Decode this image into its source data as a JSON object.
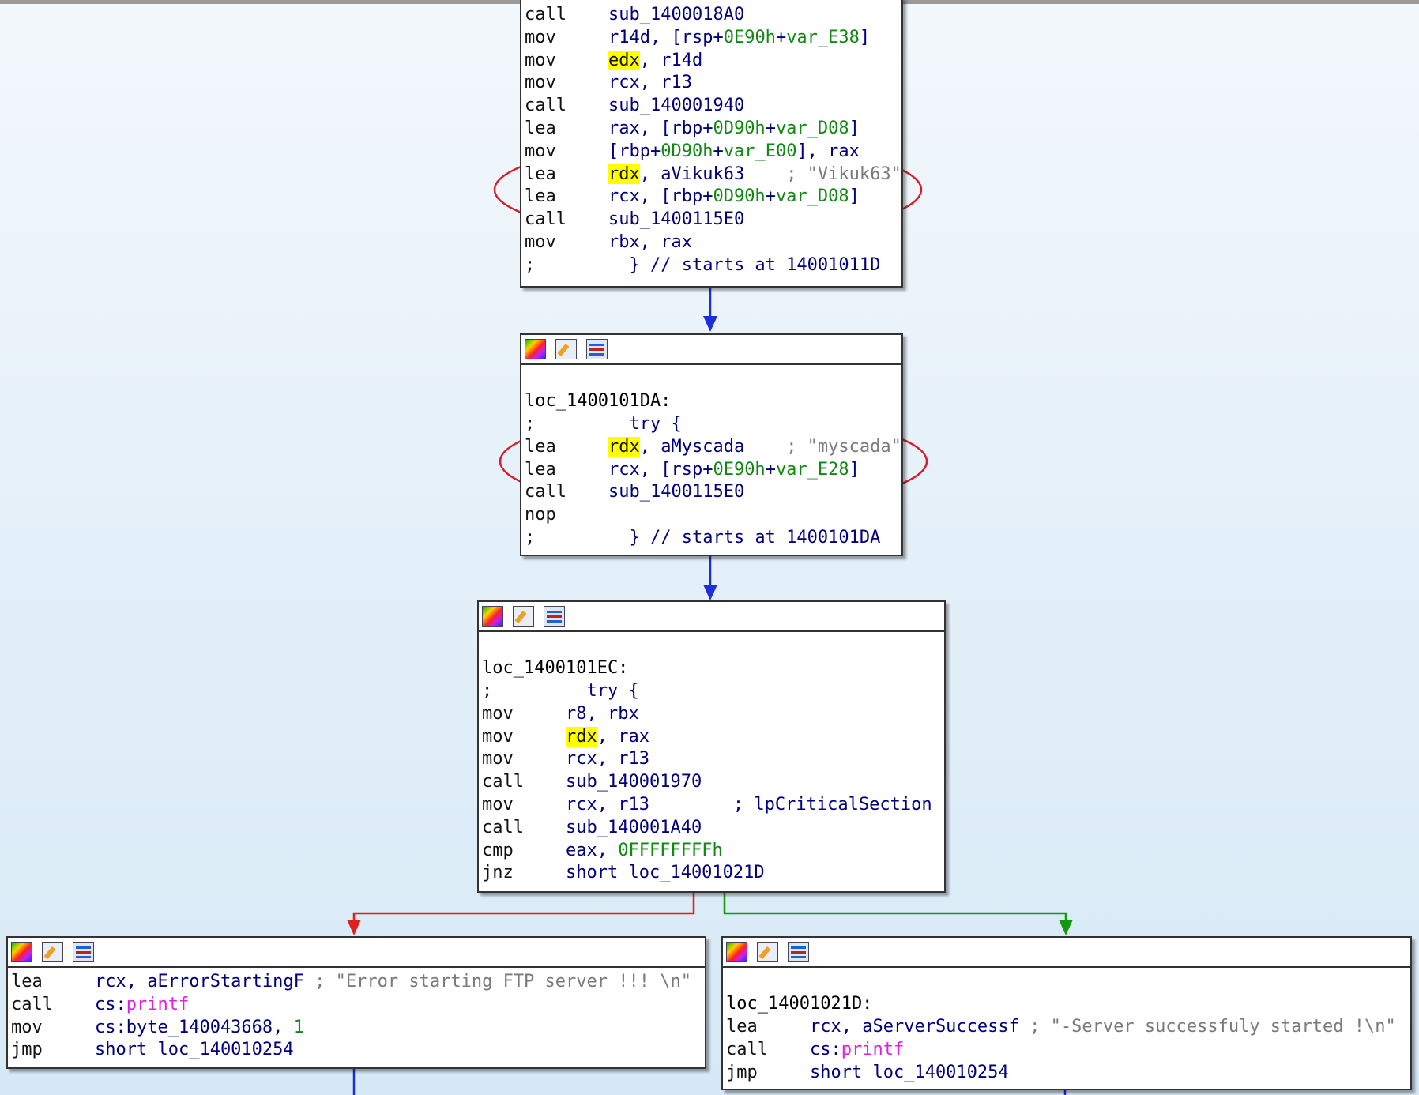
{
  "block_top": {
    "lines": [
      {
        "mn": "call",
        "ops": [
          {
            "t": "sub_1400018A0",
            "c": "ops-blue"
          }
        ]
      },
      {
        "mn": "mov",
        "ops": [
          {
            "t": "r14d, [rsp+",
            "c": "ops-blue"
          },
          {
            "t": "0E90h",
            "c": "num"
          },
          {
            "t": "+",
            "c": "ops-blue"
          },
          {
            "t": "var_E38",
            "c": "num"
          },
          {
            "t": "]",
            "c": "ops-blue"
          }
        ]
      },
      {
        "mn": "mov",
        "ops": [
          {
            "t": "edx",
            "c": "hl"
          },
          {
            "t": ", r14d",
            "c": "ops-blue"
          }
        ]
      },
      {
        "mn": "mov",
        "ops": [
          {
            "t": "rcx, r13",
            "c": "ops-blue"
          }
        ]
      },
      {
        "mn": "call",
        "ops": [
          {
            "t": "sub_140001940",
            "c": "ops-blue"
          }
        ]
      },
      {
        "mn": "lea",
        "ops": [
          {
            "t": "rax, [rbp+",
            "c": "ops-blue"
          },
          {
            "t": "0D90h",
            "c": "num"
          },
          {
            "t": "+",
            "c": "ops-blue"
          },
          {
            "t": "var_D08",
            "c": "num"
          },
          {
            "t": "]",
            "c": "ops-blue"
          }
        ]
      },
      {
        "mn": "mov",
        "ops": [
          {
            "t": "[rbp+",
            "c": "ops-blue"
          },
          {
            "t": "0D90h",
            "c": "num"
          },
          {
            "t": "+",
            "c": "ops-blue"
          },
          {
            "t": "var_E00",
            "c": "num"
          },
          {
            "t": "], rax",
            "c": "ops-blue"
          }
        ]
      },
      {
        "mn": "lea",
        "ops": [
          {
            "t": "rdx",
            "c": "hl"
          },
          {
            "t": ", aVikuk63    ",
            "c": "ops-blue"
          },
          {
            "t": "; \"Vikuk63\"",
            "c": "cmt"
          }
        ]
      },
      {
        "mn": "lea",
        "ops": [
          {
            "t": "rcx, [rbp+",
            "c": "ops-blue"
          },
          {
            "t": "0D90h",
            "c": "num"
          },
          {
            "t": "+",
            "c": "ops-blue"
          },
          {
            "t": "var_D08",
            "c": "num"
          },
          {
            "t": "]",
            "c": "ops-blue"
          }
        ]
      },
      {
        "mn": "call",
        "ops": [
          {
            "t": "sub_1400115E0",
            "c": "ops-blue"
          }
        ]
      },
      {
        "mn": "mov",
        "ops": [
          {
            "t": "rbx, rax",
            "c": "ops-blue"
          }
        ]
      },
      {
        "mn": ";",
        "ops": [
          {
            "t": "  } // starts at 14001011D",
            "c": "ops-blue"
          }
        ]
      }
    ]
  },
  "block_try1": {
    "label": "loc_1400101DA:",
    "lines": [
      {
        "mn": ";",
        "ops": [
          {
            "t": "  try {",
            "c": "ops-blue"
          }
        ]
      },
      {
        "mn": "lea",
        "ops": [
          {
            "t": "rdx",
            "c": "hl"
          },
          {
            "t": ", aMyscada    ",
            "c": "ops-blue"
          },
          {
            "t": "; \"myscada\"",
            "c": "cmt"
          }
        ]
      },
      {
        "mn": "lea",
        "ops": [
          {
            "t": "rcx, [rsp+",
            "c": "ops-blue"
          },
          {
            "t": "0E90h",
            "c": "num"
          },
          {
            "t": "+",
            "c": "ops-blue"
          },
          {
            "t": "var_E28",
            "c": "num"
          },
          {
            "t": "]",
            "c": "ops-blue"
          }
        ]
      },
      {
        "mn": "call",
        "ops": [
          {
            "t": "sub_1400115E0",
            "c": "ops-blue"
          }
        ]
      },
      {
        "mn": "nop",
        "ops": []
      },
      {
        "mn": ";",
        "ops": [
          {
            "t": "  } // starts at 1400101DA",
            "c": "ops-blue"
          }
        ]
      }
    ]
  },
  "block_try2": {
    "label": "loc_1400101EC:",
    "lines": [
      {
        "mn": ";",
        "ops": [
          {
            "t": "  try {",
            "c": "ops-blue"
          }
        ]
      },
      {
        "mn": "mov",
        "ops": [
          {
            "t": "r8, rbx",
            "c": "ops-blue"
          }
        ]
      },
      {
        "mn": "mov",
        "ops": [
          {
            "t": "rdx",
            "c": "hl"
          },
          {
            "t": ", rax",
            "c": "ops-blue"
          }
        ]
      },
      {
        "mn": "mov",
        "ops": [
          {
            "t": "rcx, r13",
            "c": "ops-blue"
          }
        ]
      },
      {
        "mn": "call",
        "ops": [
          {
            "t": "sub_140001970",
            "c": "ops-blue"
          }
        ]
      },
      {
        "mn": "mov",
        "ops": [
          {
            "t": "rcx, r13        ",
            "c": "ops-blue"
          },
          {
            "t": "; lpCriticalSection",
            "c": "ops-blue"
          }
        ]
      },
      {
        "mn": "call",
        "ops": [
          {
            "t": "sub_140001A40",
            "c": "ops-blue"
          }
        ]
      },
      {
        "mn": "cmp",
        "ops": [
          {
            "t": "eax, ",
            "c": "ops-blue"
          },
          {
            "t": "0FFFFFFFFh",
            "c": "num"
          }
        ]
      },
      {
        "mn": "jnz",
        "ops": [
          {
            "t": "short loc_14001021D",
            "c": "ops-blue"
          }
        ]
      }
    ]
  },
  "block_error": {
    "lines": [
      {
        "mn": "lea",
        "ops": [
          {
            "t": "rcx, aErrorStartingF ",
            "c": "ops-blue"
          },
          {
            "t": "; \"Error starting FTP server !!! \\n\"",
            "c": "cmt"
          }
        ]
      },
      {
        "mn": "call",
        "ops": [
          {
            "t": "cs:",
            "c": "ops-blue"
          },
          {
            "t": "printf",
            "c": "imp"
          }
        ]
      },
      {
        "mn": "mov",
        "ops": [
          {
            "t": "cs:byte_140043668, ",
            "c": "ops-blue"
          },
          {
            "t": "1",
            "c": "num"
          }
        ]
      },
      {
        "mn": "jmp",
        "ops": [
          {
            "t": "short loc_140010254",
            "c": "ops-blue"
          }
        ]
      }
    ]
  },
  "block_success": {
    "label": "loc_14001021D:",
    "lines": [
      {
        "mn": "lea",
        "ops": [
          {
            "t": "rcx, aServerSuccessf ",
            "c": "ops-blue"
          },
          {
            "t": "; \"-Server successfuly started !\\n\"",
            "c": "cmt"
          }
        ]
      },
      {
        "mn": "call",
        "ops": [
          {
            "t": "cs:",
            "c": "ops-blue"
          },
          {
            "t": "printf",
            "c": "imp"
          }
        ]
      },
      {
        "mn": "jmp",
        "ops": [
          {
            "t": "short loc_140010254",
            "c": "ops-blue"
          }
        ]
      }
    ]
  },
  "colors": {
    "edge_normal": "#1f2fd6",
    "edge_false": "#e02020",
    "edge_true": "#119911",
    "annotation": "#d81e2a",
    "highlight": "#ffff00"
  }
}
